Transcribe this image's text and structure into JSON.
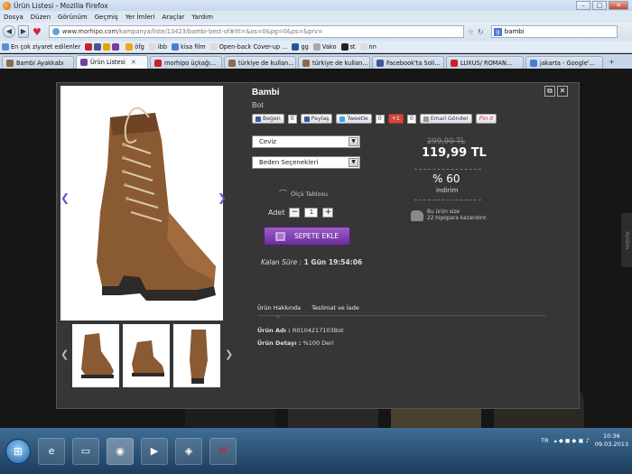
{
  "window": {
    "title": "Ürün Listesi - Mozilla Firefox"
  },
  "menu": [
    "Dosya",
    "Düzen",
    "Görünüm",
    "Geçmiş",
    "Yer İmleri",
    "Araçlar",
    "Yardım"
  ],
  "navbar": {
    "url_host": "www.morhipo.com",
    "url_path": "/kampanya/liste/13423/bambi-best-of#itt=&os=0&pg=0&ps=&prv=",
    "search_value": "bambi"
  },
  "bookmarks": [
    "En çok ziyaret edilenler",
    "öfg",
    "ibb",
    "kisa film",
    "Open-back Cover-up ...",
    "gg",
    "Vako",
    "st",
    "nn"
  ],
  "tabs": [
    {
      "label": "Bambi Ayakkabı",
      "color": "#8a6a4a"
    },
    {
      "label": "Ürün Listesi",
      "color": "#7a3d9b",
      "active": true
    },
    {
      "label": "morhipo üçkağı...",
      "color": "#c3232b"
    },
    {
      "label": "türkiye de kullan...",
      "color": "#8a6a4a"
    },
    {
      "label": "türkiye de kullan...",
      "color": "#8a6a4a"
    },
    {
      "label": "Facebook'ta Soli...",
      "color": "#3b5998"
    },
    {
      "label": "LUXUS/ ROMAN...",
      "color": "#cc2222"
    },
    {
      "label": "jakarta - Google'...",
      "color": "#4a7bd4"
    }
  ],
  "product": {
    "brand": "Bambi",
    "type": "Bot",
    "social": {
      "like": "Beğen",
      "like_count": "0",
      "share": "Paylaş",
      "tweet": "Tweetle",
      "tweet_count": "0",
      "plus": "+1",
      "plus_count": "0",
      "email": "Email Gönder",
      "pin": "Pin it"
    },
    "color_select": "Ceviz",
    "size_select": "Beden Seçenekleri",
    "size_chart": "Ölçü Tablosu",
    "qty_label": "Adet",
    "qty_value": "1",
    "qty_minus": "−",
    "qty_plus": "+",
    "cart_button": "SEPETE EKLE",
    "time_left_label": "Kalan Süre :",
    "time_left_value": "1 Gün 19:54:06",
    "old_price": "299,90 TL",
    "new_price": "119,99 TL",
    "discount_pct": "% 60",
    "discount_label": "indirim",
    "hipo_line1": "Bu ürün size",
    "hipo_line2": "22 hipopara kazandırır.",
    "detail_tabs": [
      "Ürün Hakkında",
      "Teslimat ve İade"
    ],
    "detail_name_label": "Ürün Adı :",
    "detail_name_value": "R0104217103Bot",
    "detail_desc_label": "Ürün Detayı :",
    "detail_desc_value": "%100 Deri"
  },
  "side_tab": "Yardım",
  "taskbar": {
    "lang": "TR",
    "time": "10:36",
    "date": "09.03.2013"
  },
  "colors": {
    "accent_purple": "#7a3d9b",
    "nav_arrow": "#6a4fc8",
    "modal_bg": "#363636"
  }
}
